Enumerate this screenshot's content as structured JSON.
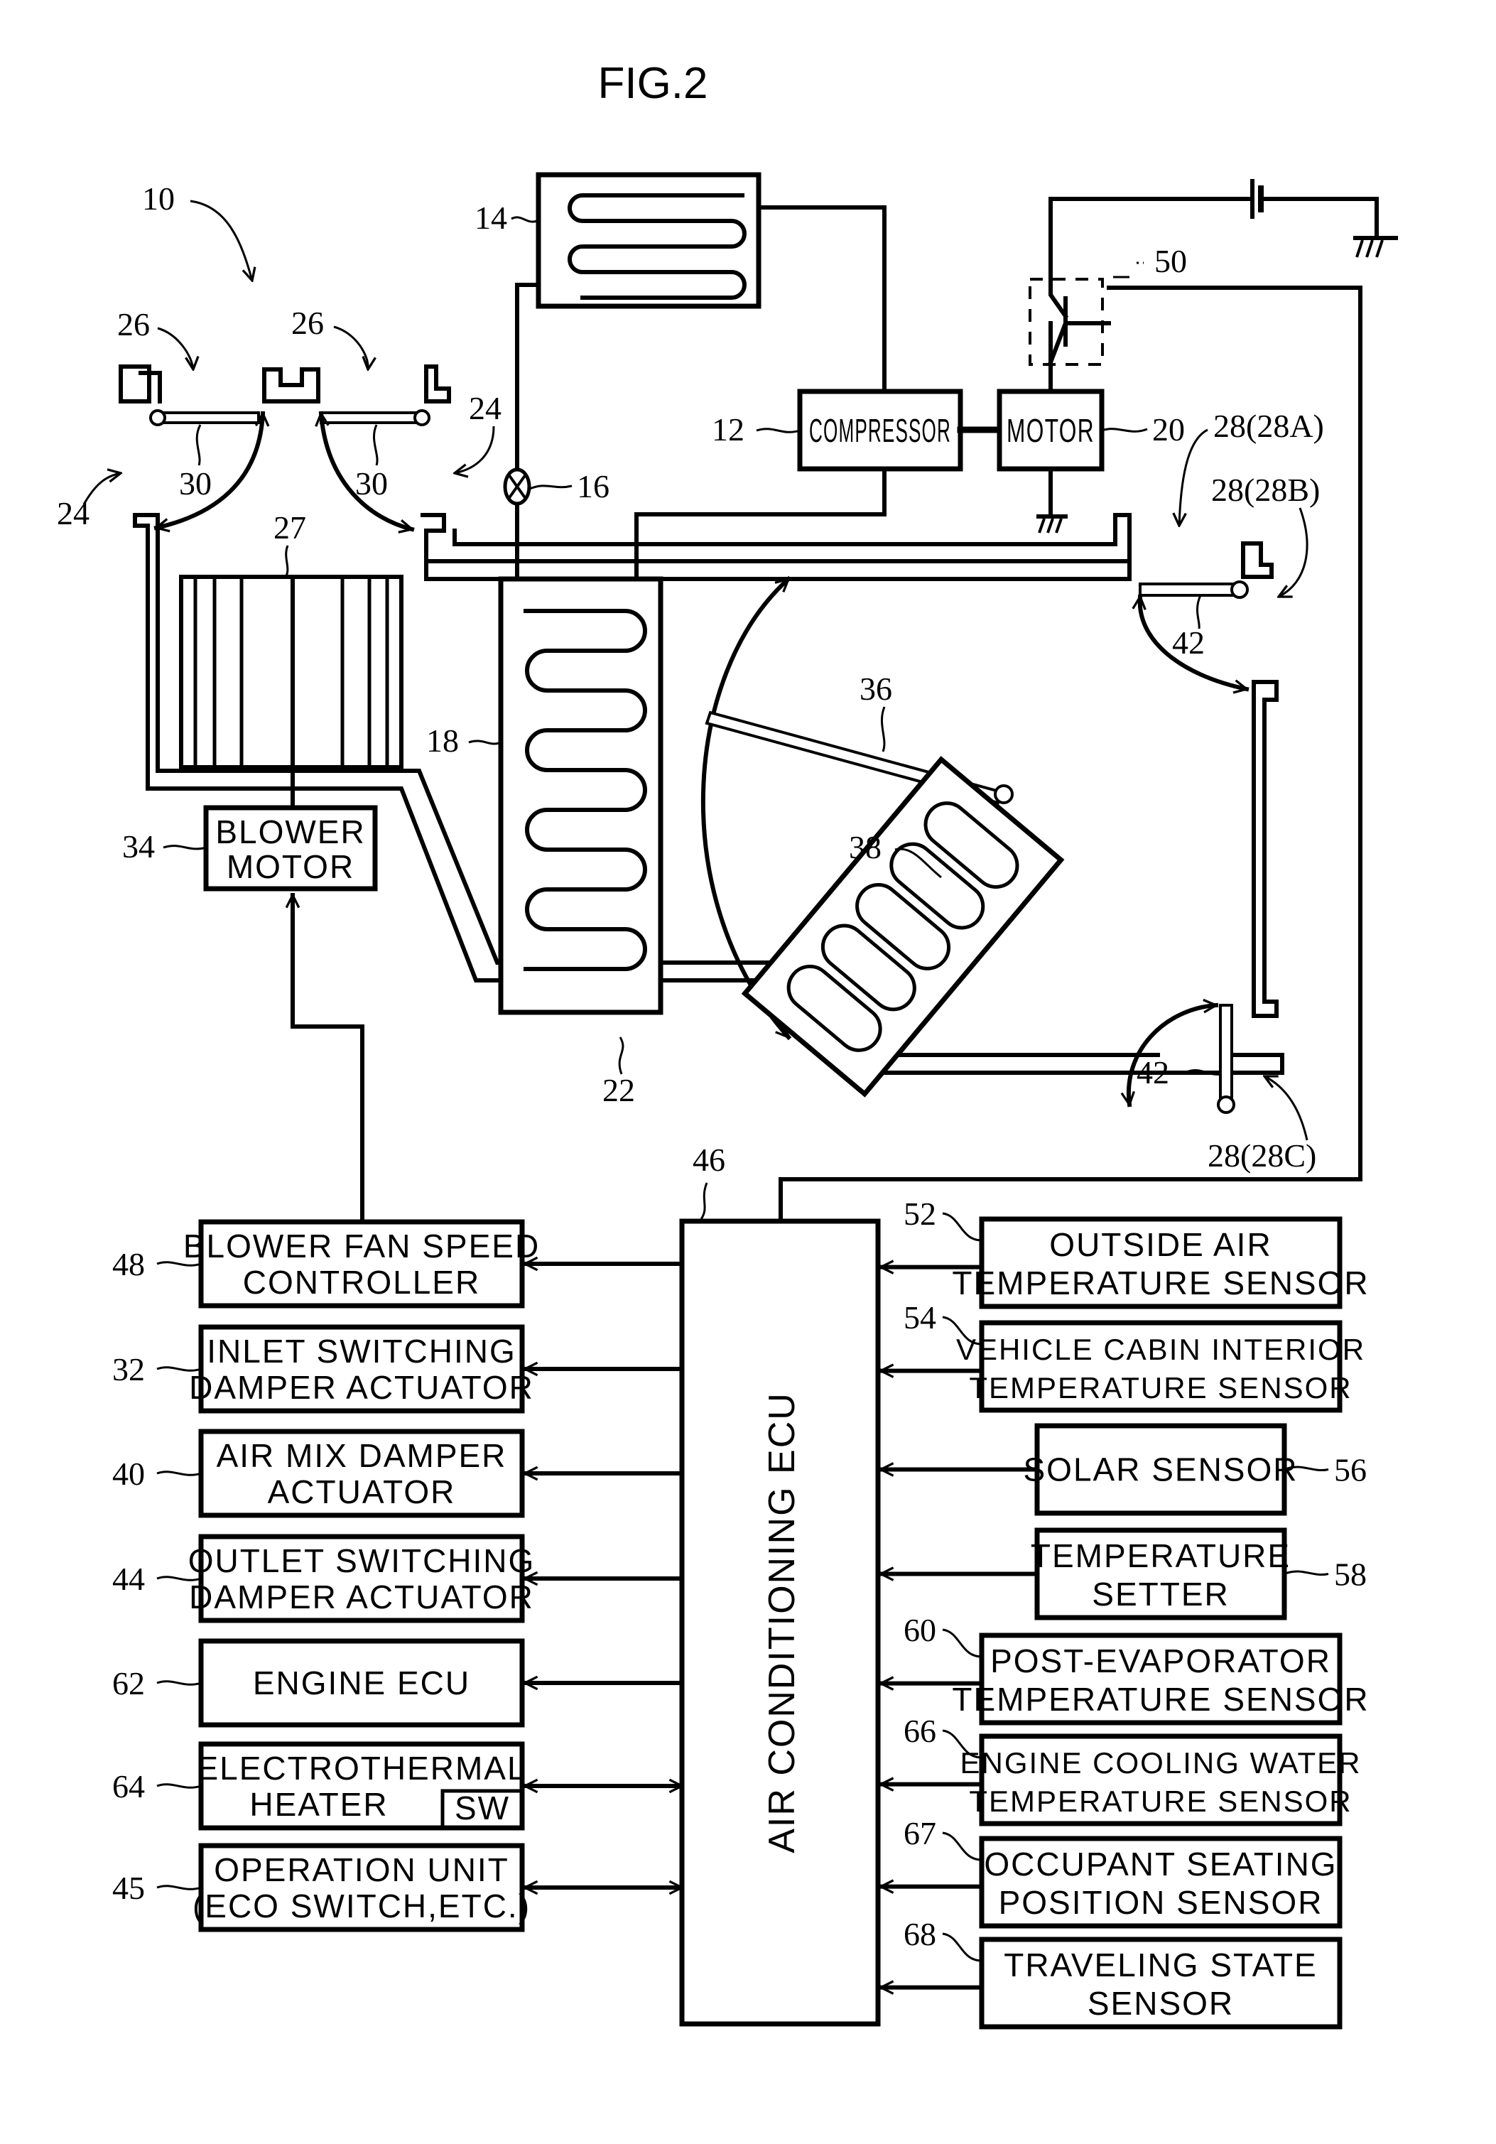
{
  "figure": {
    "title": "FIG.2",
    "system_ref": "10"
  },
  "refrigeration": {
    "condenser_ref": "14",
    "compressor": {
      "label": "COMPRESSOR",
      "ref": "12"
    },
    "motor": {
      "label": "MOTOR",
      "ref": "20"
    },
    "expansion_valve_ref": "16",
    "evaporator_ref": "18",
    "switch_ref": "50"
  },
  "air_duct": {
    "duct_ref": "22",
    "inlet_refs": [
      "26",
      "26"
    ],
    "inlet_damper_refs": [
      "30",
      "30"
    ],
    "inlet_path_refs": [
      "24",
      "24"
    ],
    "blower_fan_ref": "27",
    "blower_motor": {
      "label_line1": "BLOWER",
      "label_line2": "MOTOR",
      "ref": "34"
    },
    "air_mix_damper_ref": "36",
    "heater_core_ref": "38",
    "outlet_damper_refs": [
      "42",
      "42"
    ],
    "outlet_refs": [
      "28(28A)",
      "28(28B)",
      "28(28C)"
    ]
  },
  "ecu": {
    "label": "AIR CONDITIONING ECU",
    "ref": "46"
  },
  "outputs": [
    {
      "ref": "48",
      "line1": "BLOWER FAN SPEED",
      "line2": "CONTROLLER",
      "direction": "out"
    },
    {
      "ref": "32",
      "line1": "INLET SWITCHING",
      "line2": "DAMPER ACTUATOR",
      "direction": "out"
    },
    {
      "ref": "40",
      "line1": "AIR MIX DAMPER",
      "line2": "ACTUATOR",
      "direction": "out"
    },
    {
      "ref": "44",
      "line1": "OUTLET SWITCHING",
      "line2": "DAMPER ACTUATOR",
      "direction": "out"
    },
    {
      "ref": "62",
      "line1": "ENGINE ECU",
      "line2": "",
      "direction": "out"
    },
    {
      "ref": "64",
      "line1": "ELECTROTHERMAL",
      "line2": "HEATER",
      "sub": "SW",
      "direction": "both"
    },
    {
      "ref": "45",
      "line1": "OPERATION UNIT",
      "line2": "(ECO SWITCH,ETC.)",
      "direction": "both"
    }
  ],
  "inputs": [
    {
      "ref": "52",
      "line1": "OUTSIDE AIR",
      "line2": "TEMPERATURE SENSOR"
    },
    {
      "ref": "54",
      "line1": "VEHICLE CABIN INTERIOR",
      "line2": "TEMPERATURE SENSOR"
    },
    {
      "ref": "56",
      "line1": "SOLAR SENSOR",
      "line2": ""
    },
    {
      "ref": "58",
      "line1": "TEMPERATURE",
      "line2": "SETTER"
    },
    {
      "ref": "60",
      "line1": "POST-EVAPORATOR",
      "line2": "TEMPERATURE SENSOR"
    },
    {
      "ref": "66",
      "line1": "ENGINE COOLING WATER",
      "line2": "TEMPERATURE SENSOR"
    },
    {
      "ref": "67",
      "line1": "OCCUPANT SEATING",
      "line2": "POSITION SENSOR"
    },
    {
      "ref": "68",
      "line1": "TRAVELING STATE",
      "line2": "SENSOR"
    }
  ]
}
